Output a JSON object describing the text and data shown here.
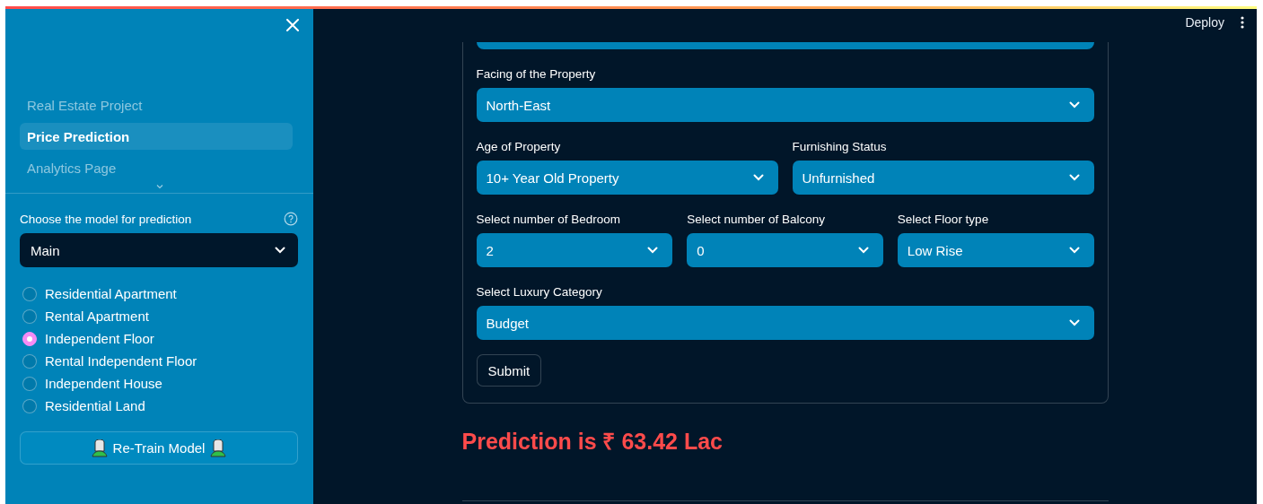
{
  "header": {
    "deploy": "Deploy"
  },
  "sidebar": {
    "nav": [
      {
        "label": "Real Estate Project",
        "selected": false
      },
      {
        "label": "Price Prediction",
        "selected": true
      },
      {
        "label": "Analytics Page",
        "selected": false
      }
    ],
    "model_select": {
      "label": "Choose the model for prediction",
      "value": "Main"
    },
    "property_types": [
      {
        "label": "Residential Apartment",
        "selected": false
      },
      {
        "label": "Rental Apartment",
        "selected": false
      },
      {
        "label": "Independent Floor",
        "selected": true
      },
      {
        "label": "Rental Independent Floor",
        "selected": false
      },
      {
        "label": "Independent House",
        "selected": false
      },
      {
        "label": "Residential Land",
        "selected": false
      }
    ],
    "retrain_button": "Re-Train Model"
  },
  "form": {
    "rows": [
      [
        {
          "label": "Facing of the Property",
          "value": "North-East"
        }
      ],
      [
        {
          "label": "Age of Property",
          "value": "10+ Year Old Property"
        },
        {
          "label": "Furnishing Status",
          "value": "Unfurnished"
        }
      ],
      [
        {
          "label": "Select number of Bedroom",
          "value": "2"
        },
        {
          "label": "Select number of Balcony",
          "value": "0"
        },
        {
          "label": "Select Floor type",
          "value": "Low Rise"
        }
      ],
      [
        {
          "label": "Select Luxury Category",
          "value": "Budget"
        }
      ]
    ],
    "submit": "Submit"
  },
  "prediction": "Prediction is ₹ 63.42 Lac"
}
